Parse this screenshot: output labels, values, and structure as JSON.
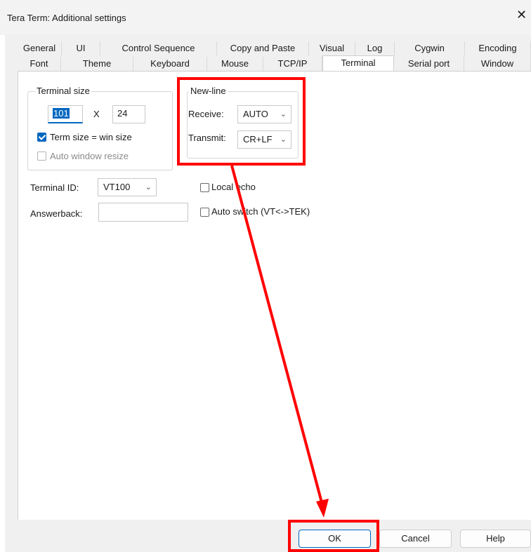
{
  "window": {
    "title": "Tera Term: Additional settings",
    "close_glyph": "✕"
  },
  "tabs": {
    "row1": [
      "General",
      "UI",
      "Control Sequence",
      "Copy and Paste",
      "Visual",
      "Log",
      "Cygwin",
      "Encoding"
    ],
    "row2": [
      "Font",
      "Theme",
      "Keyboard",
      "Mouse",
      "TCP/IP",
      "Terminal",
      "Serial port",
      "Window"
    ],
    "selected": "Terminal"
  },
  "terminal_size": {
    "legend": "Terminal size",
    "width_value": "101",
    "x_label": "X",
    "height_value": "24",
    "term_size_label": "Term size = win size",
    "term_size_checked": true,
    "auto_resize_label": "Auto window resize",
    "auto_resize_checked": false
  },
  "newline": {
    "legend": "New-line",
    "receive_label": "Receive:",
    "receive_value": "AUTO",
    "transmit_label": "Transmit:",
    "transmit_value": "CR+LF"
  },
  "terminal_id": {
    "label": "Terminal ID:",
    "value": "VT100"
  },
  "answerback": {
    "label": "Answerback:",
    "value": ""
  },
  "local_echo": {
    "label": "Local echo",
    "checked": false
  },
  "auto_switch": {
    "label": "Auto switch (VT<->TEK)",
    "checked": false
  },
  "buttons": {
    "ok": "OK",
    "cancel": "Cancel",
    "help": "Help"
  },
  "icons": {
    "dropdown": "chevron-down-icon",
    "check": "check-icon"
  },
  "colors": {
    "accent": "#0067c0",
    "annotation": "#ff0000",
    "panel": "#ffffff",
    "dialog": "#f0f0f0"
  }
}
